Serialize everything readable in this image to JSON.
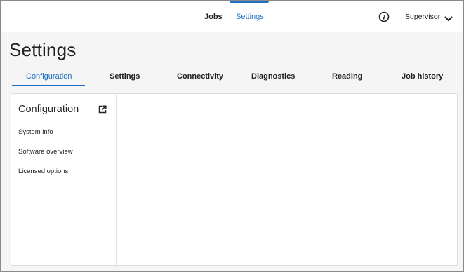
{
  "topbar": {
    "nav": [
      {
        "label": "Jobs",
        "active": false
      },
      {
        "label": "Settings",
        "active": true
      }
    ],
    "help_icon": "help-circle-icon",
    "user": "Supervisor",
    "user_menu_icon": "chevron-down-icon"
  },
  "page": {
    "title": "Settings"
  },
  "tabs": [
    {
      "label": "Configuration",
      "active": true
    },
    {
      "label": "Settings",
      "active": false
    },
    {
      "label": "Connectivity",
      "active": false
    },
    {
      "label": "Diagnostics",
      "active": false
    },
    {
      "label": "Reading",
      "active": false
    },
    {
      "label": "Job history",
      "active": false
    }
  ],
  "side_panel": {
    "title": "Configuration",
    "open_icon": "external-link-icon",
    "items": [
      {
        "label": "System info"
      },
      {
        "label": "Software overview"
      },
      {
        "label": "Licensed options"
      }
    ]
  },
  "colors": {
    "accent": "#1f6fc5",
    "page_background": "#f5f5f5",
    "card_background": "#ffffff"
  }
}
